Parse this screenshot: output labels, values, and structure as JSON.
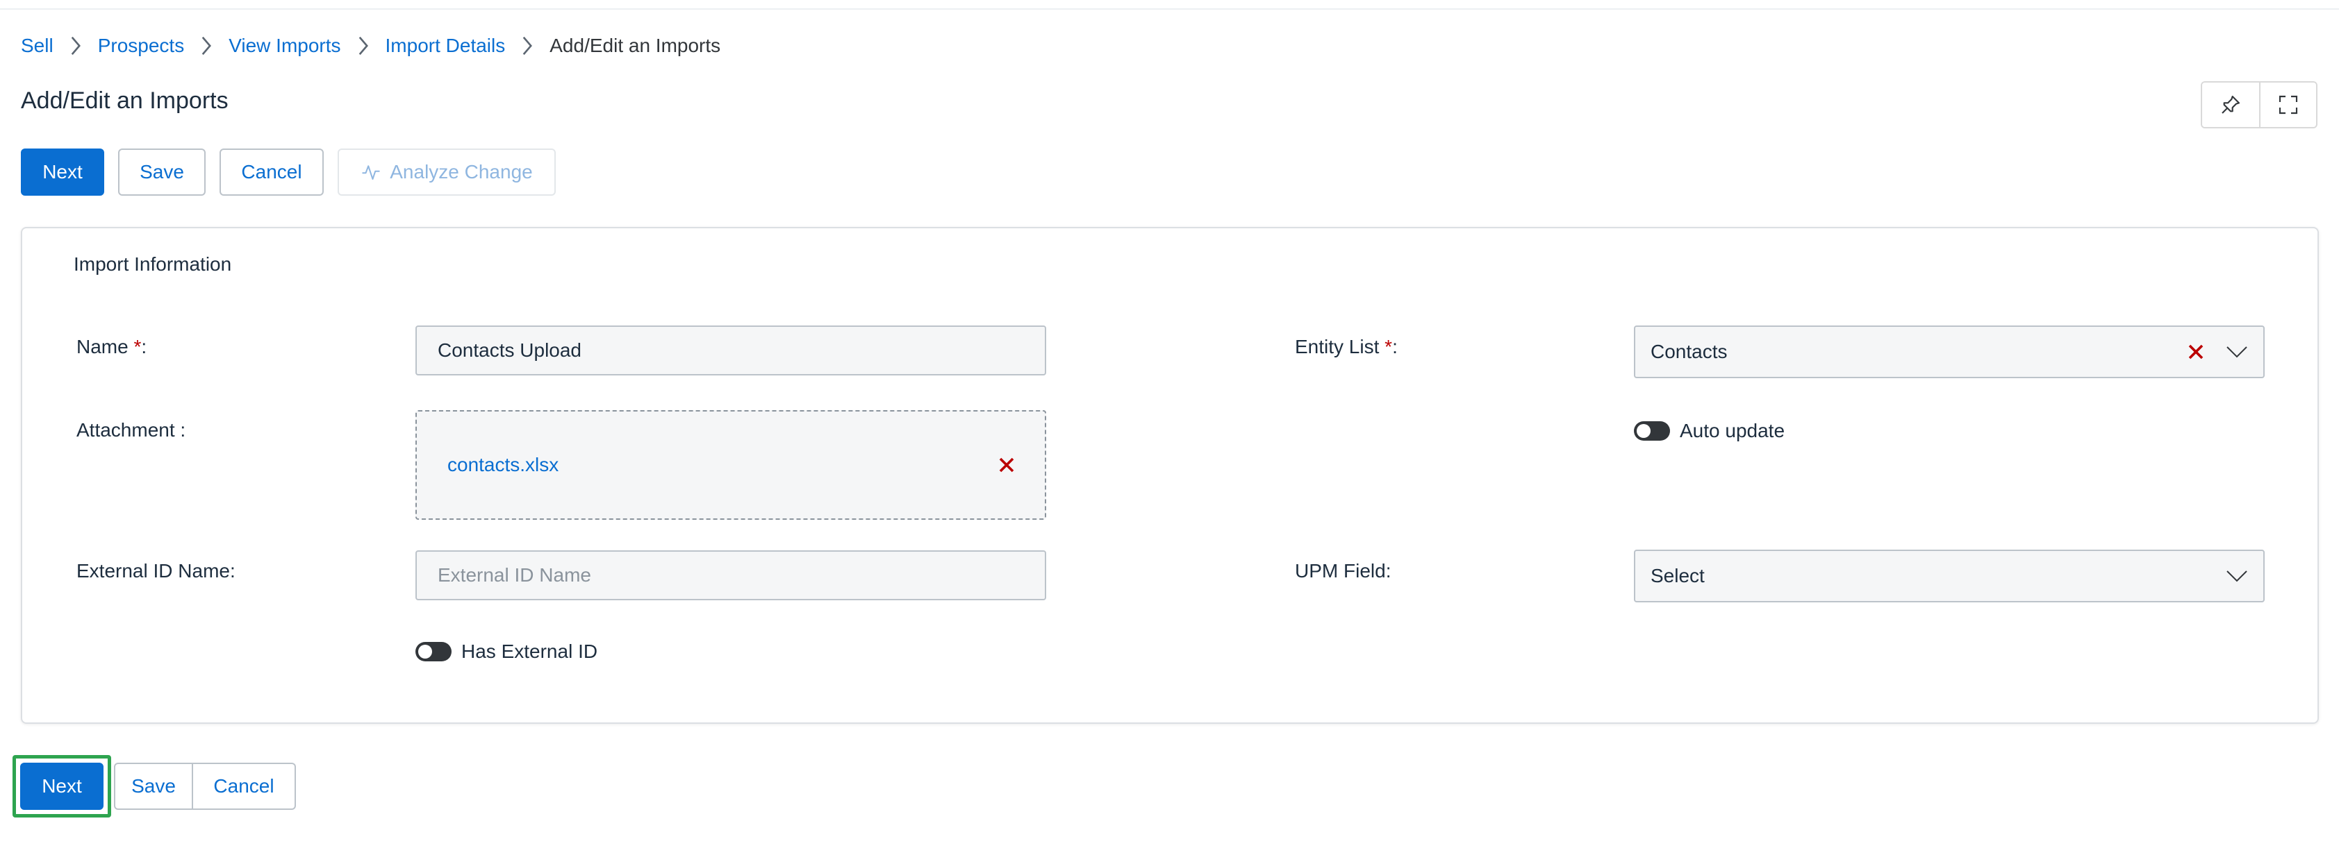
{
  "breadcrumb": {
    "items": [
      "Sell",
      "Prospects",
      "View Imports",
      "Import Details"
    ],
    "current": "Add/Edit an Imports"
  },
  "page": {
    "title": "Add/Edit an Imports"
  },
  "header_actions": {
    "pin_icon": "pin-icon",
    "fullscreen_icon": "fullscreen-icon"
  },
  "toolbar": {
    "next_label": "Next",
    "save_label": "Save",
    "cancel_label": "Cancel",
    "analyze_label": "Analyze Change",
    "analyze_icon": "activity-icon",
    "analyze_disabled": true
  },
  "section": {
    "title": "Import Information",
    "name": {
      "label": "Name",
      "required_mark": "*",
      "suffix": ":",
      "value": "Contacts Upload"
    },
    "attachment": {
      "label": "Attachment :",
      "file_name": "contacts.xlsx"
    },
    "external_id_name": {
      "label": "External ID Name:",
      "value": "",
      "placeholder": "External ID Name"
    },
    "has_external_id": {
      "label": "Has External ID",
      "on": false
    },
    "entity_list": {
      "label": "Entity List",
      "required_mark": "*",
      "suffix": ":",
      "value": "Contacts"
    },
    "auto_update": {
      "label": "Auto update",
      "on": false
    },
    "upm_field": {
      "label": "UPM Field:",
      "value": "Select"
    }
  },
  "footer": {
    "next_label": "Next",
    "save_label": "Save",
    "cancel_label": "Cancel"
  },
  "colors": {
    "accent": "#0a6ed1",
    "error": "#bb0000",
    "focus": "#2ea44f"
  }
}
